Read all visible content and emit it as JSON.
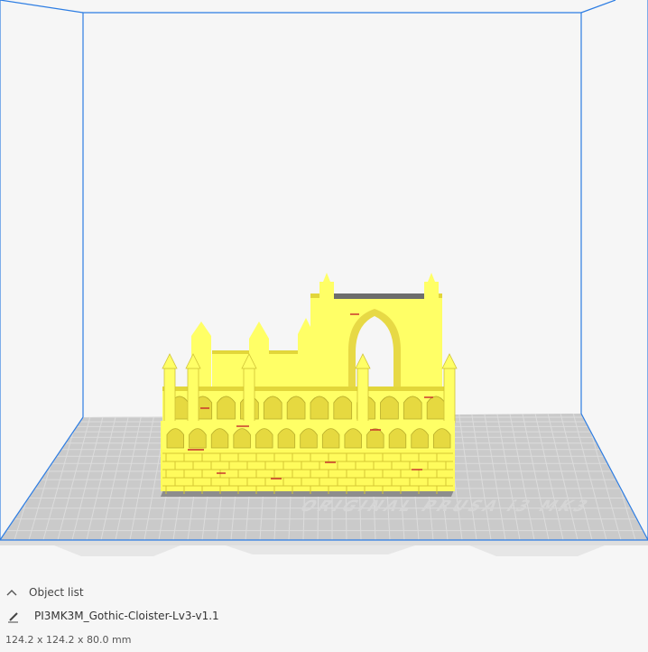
{
  "viewport": {
    "bed_watermark": "ORIGINAL PRUSA i3 MK3",
    "colors": {
      "background": "#f6f6f6",
      "build_volume_edge": "#2d7de3",
      "bed_surface": "#c9c9c9",
      "bed_grid": "#d9d9d9",
      "model": "#ffff66",
      "model_shade": "#e4d840",
      "model_overhang": "#c62b2b"
    }
  },
  "object_list": {
    "header_label": "Object list",
    "header_icon": "chevron-up-icon",
    "items": [
      {
        "name": "PI3MK3M_Gothic-Cloister-Lv3-v1.1",
        "icon": "pencil-icon"
      }
    ],
    "dimensions": "124.2 x 124.2 x 80.0 mm"
  }
}
